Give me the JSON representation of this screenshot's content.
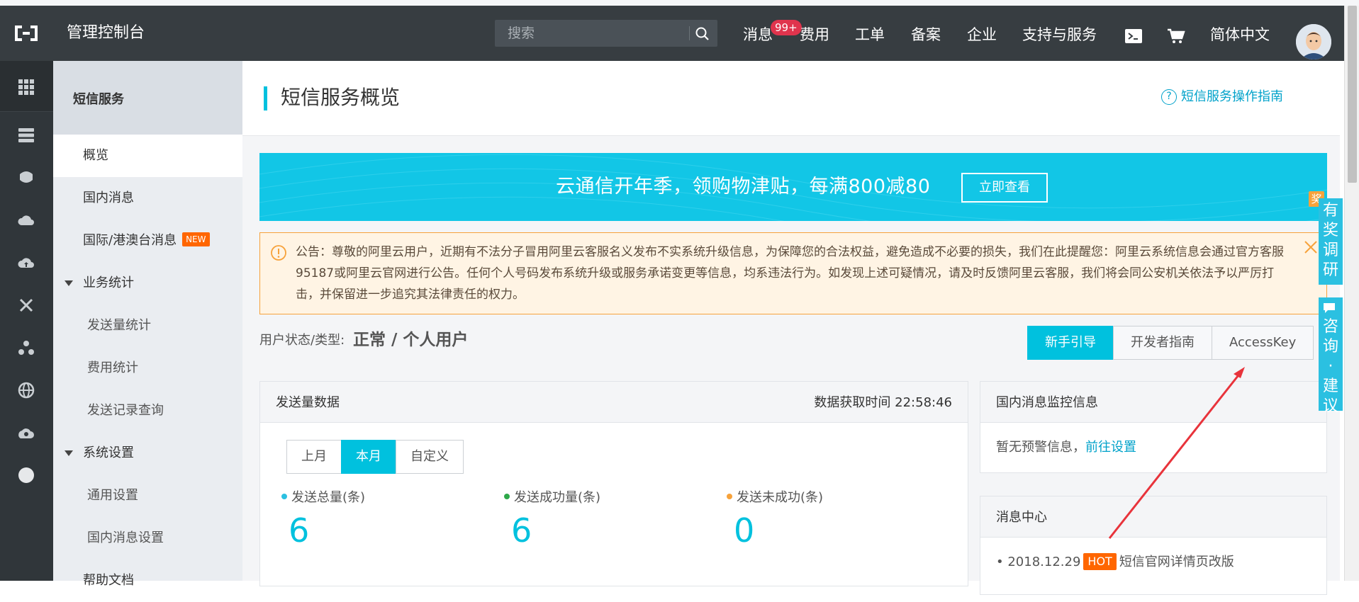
{
  "topbar": {
    "brand": "管理控制台",
    "search_placeholder": "搜索",
    "nav": {
      "messages": "消息",
      "messages_badge": "99+",
      "billing": "费用",
      "tickets": "工单",
      "icp": "备案",
      "enterprise": "企业",
      "support": "支持与服务",
      "language": "简体中文"
    }
  },
  "sidebar": {
    "title": "短信服务",
    "items": [
      {
        "label": "概览"
      },
      {
        "label": "国内消息"
      },
      {
        "label": "国际/港澳台消息",
        "badge": "NEW"
      },
      {
        "label": "业务统计"
      },
      {
        "label": "发送量统计"
      },
      {
        "label": "费用统计"
      },
      {
        "label": "发送记录查询"
      },
      {
        "label": "系统设置"
      },
      {
        "label": "通用设置"
      },
      {
        "label": "国内消息设置"
      },
      {
        "label": "帮助文档"
      }
    ]
  },
  "main": {
    "title": "短信服务概览",
    "guide_link": "短信服务操作指南",
    "banner": {
      "text": "云通信开年季，领购物津贴，每满800减80",
      "button": "立即查看"
    },
    "notice": "公告：尊敬的阿里云用户，近期有不法分子冒用阿里云客服名义发布不实系统升级信息，为保障您的合法权益，避免造成不必要的损失，我们在此提醒您：阿里云系统信息会通过官方客服95187或阿里云官网进行公告。任何个人号码发布系统升级或服务承诺变更等信息，均系违法行为。如发现上述可疑情况，请及时反馈阿里云客服，我们将会同公安机关依法予以严厉打击，并保留进一步追究其法律责任的权力。",
    "user_status_label": "用户状态/类型:",
    "user_status_value": "正常 / 个人用户",
    "buttons": {
      "newbie": "新手引导",
      "dev_guide": "开发者指南",
      "accesskey": "AccessKey"
    },
    "send_card": {
      "title": "发送量数据",
      "fetch_time": "数据获取时间 22:58:46",
      "tabs": [
        "上月",
        "本月",
        "自定义"
      ],
      "stats": [
        {
          "label": "发送总量(条)",
          "value": "6",
          "color": "#2bc0e1"
        },
        {
          "label": "发送成功量(条)",
          "value": "6",
          "color": "#2ea84a"
        },
        {
          "label": "发送未成功(条)",
          "value": "0",
          "color": "#f7a23b"
        }
      ]
    },
    "monitor_card": {
      "title": "国内消息监控信息",
      "text": "暂无预警信息，",
      "link": "前往设置"
    },
    "msg_card": {
      "title": "消息中心",
      "item_date": "2018.12.29",
      "item_badge": "HOT",
      "item_text": "短信官网详情页改版"
    }
  },
  "float": {
    "award_badge": "奖",
    "survey": "有奖调研",
    "feedback": "咨询·建议"
  }
}
